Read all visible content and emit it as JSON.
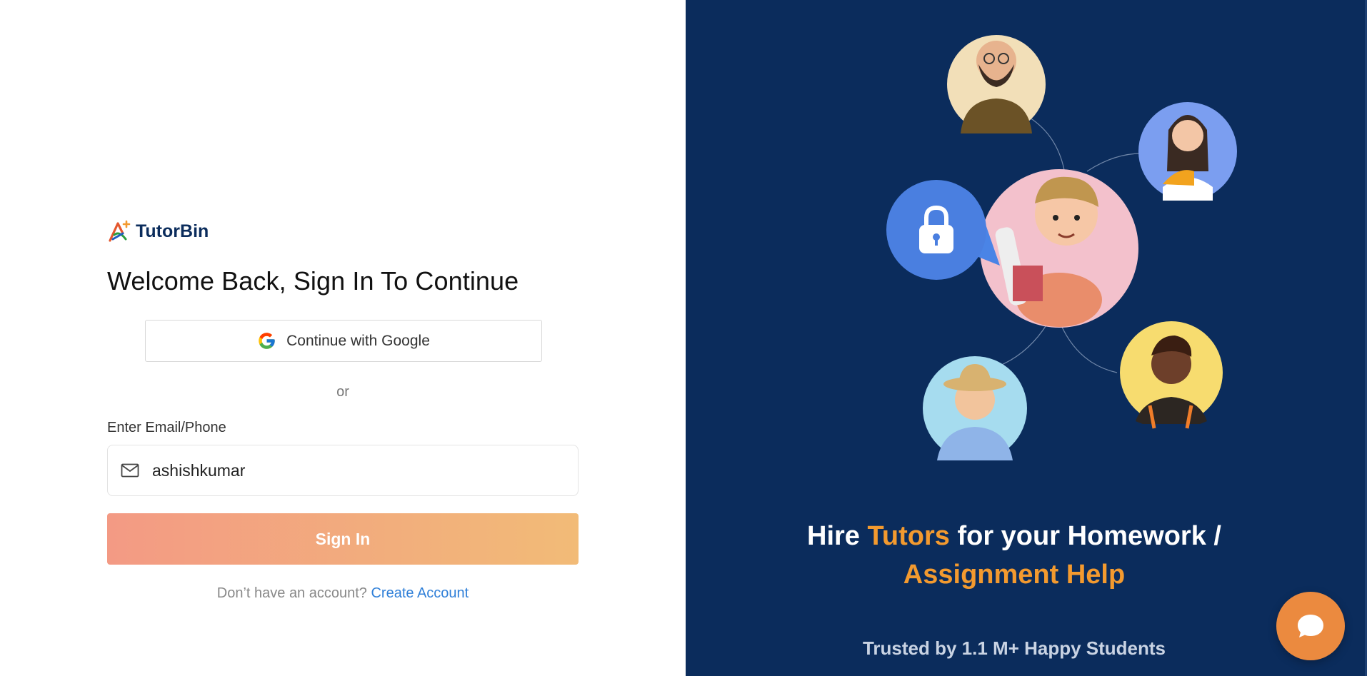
{
  "brand": {
    "name": "TutorBin"
  },
  "login": {
    "heading": "Welcome Back, Sign In To Continue",
    "google_button_label": "Continue with Google",
    "separator": "or",
    "email_label": "Enter Email/Phone",
    "email_value": "ashishkumar",
    "signin_label": "Sign In",
    "no_account_text": "Don’t have an account?",
    "create_account_label": "Create Account"
  },
  "promo": {
    "line1_prefix": "Hire ",
    "line1_accent": "Tutors",
    "line1_suffix": " for your Homework /",
    "line2": "Assignment Help",
    "trusted_text": "Trusted by 1.1 M+ Happy Students"
  },
  "icons": {
    "logo": "tutorbin-logo-icon",
    "google": "google-icon",
    "mail": "mail-icon",
    "lock": "lock-icon",
    "chat": "chat-bubble-icon"
  },
  "colors": {
    "panel_bg": "#0b2c5c",
    "accent_orange": "#f39a2f",
    "signin_gradient_start": "#f39a84",
    "signin_gradient_end": "#f2bb77",
    "link_blue": "#2f7fd8",
    "chat_button": "#eb8a3f"
  }
}
